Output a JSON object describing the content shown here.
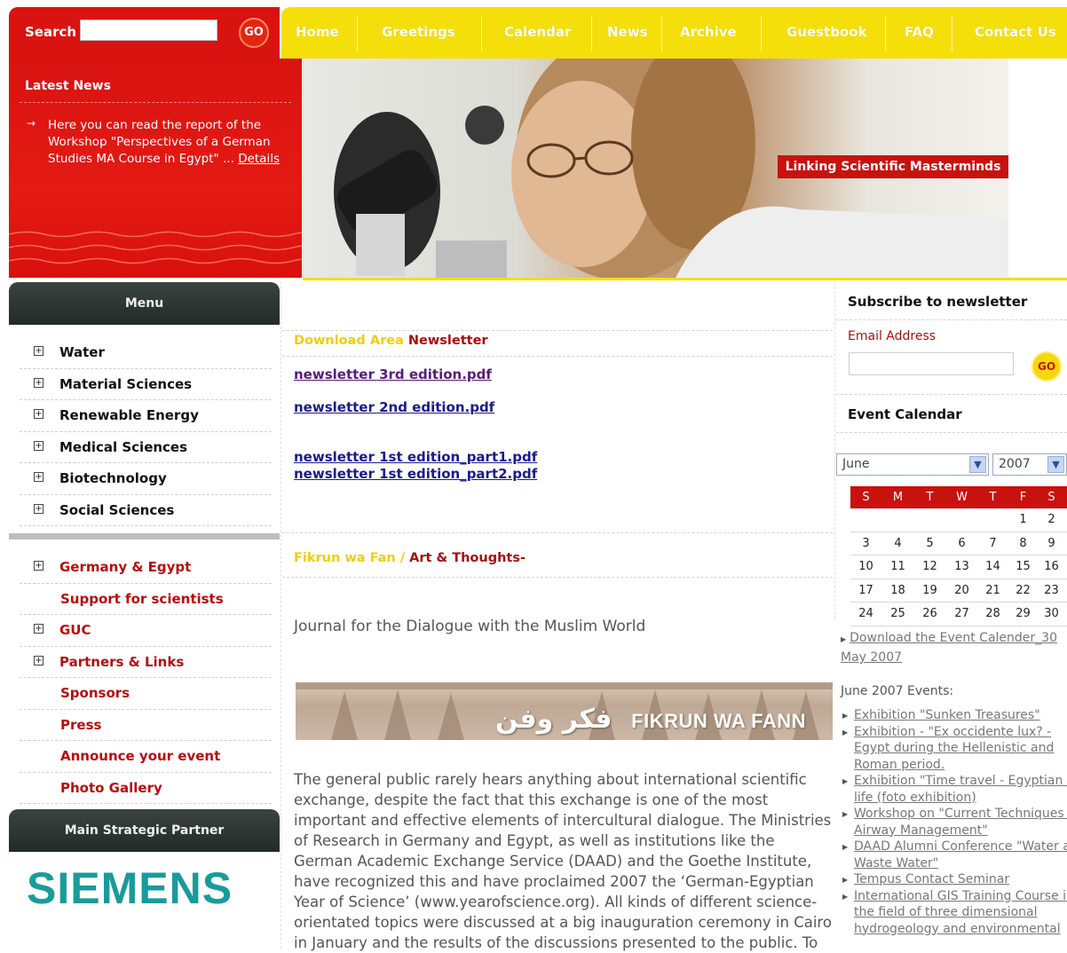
{
  "search": {
    "label": "Search",
    "value": "",
    "go_label": "GO"
  },
  "nav": {
    "items": [
      "Home",
      "Greetings",
      "Calendar",
      "News",
      "Archive",
      "Guestbook",
      "FAQ",
      "Contact Us"
    ]
  },
  "latest_news": {
    "title": "Latest News",
    "text": "Here you can read the report of the Workshop \"Perspectives of a German Studies MA Course in Egypt\" ... ",
    "details_link": "Details"
  },
  "hero": {
    "tagline": "Linking Scientific Masterminds"
  },
  "menu": {
    "title": "Menu",
    "science_items": [
      "Water",
      "Material Sciences",
      "Renewable Energy",
      "Medical Sciences",
      "Biotechnology",
      "Social Sciences"
    ],
    "info_items": [
      {
        "label": "Germany & Egypt",
        "expandable": true
      },
      {
        "label": "Support for scientists",
        "expandable": false
      },
      {
        "label": "GUC",
        "expandable": true
      },
      {
        "label": "Partners & Links",
        "expandable": true
      },
      {
        "label": "Sponsors",
        "expandable": false
      },
      {
        "label": "Press",
        "expandable": false
      },
      {
        "label": "Announce your event",
        "expandable": false
      },
      {
        "label": "Photo Gallery",
        "expandable": false
      }
    ]
  },
  "partner": {
    "title": "Main Strategic Partner",
    "logo_text": "SIEMENS"
  },
  "download": {
    "title_part1": "Download Area",
    "title_part2": "Newsletter",
    "links": [
      "newsletter 3rd edition.pdf",
      "newsletter 2nd edition.pdf",
      "newsletter 1st edition_part1.pdf",
      "newsletter 1st edition_part2.pdf"
    ]
  },
  "fikrun": {
    "title_part1": "Fikrun wa  Fan /",
    "title_part2": "Art & Thoughts-",
    "subtitle": "Journal for the Dialogue with the Muslim World",
    "banner_text": "FIKRUN WA FANN",
    "banner_arabic": "فكر وفن",
    "body": "The general public rarely hears anything about international scientific exchange, despite the fact that this exchange is one of the most important and effective elements of intercultural dialogue. The Ministries of Research in Germany and Egypt, as well as institutions like the German Academic Exchange Service (DAAD) and the Goethe Institute, have recognized this and have proclaimed 2007 the ‘German-Egyptian Year of Science’ (www.yearofscience.org). All kinds of different science-orientated topics were discussed at a big inauguration ceremony in Cairo in January and the results of the discussions presented to the public. To"
  },
  "newsletter": {
    "title": "Subscribe to newsletter",
    "email_label": "Email Address",
    "email_value": "",
    "go_label": "GO"
  },
  "event_calendar": {
    "title": "Event Calendar",
    "month": "June",
    "year": "2007",
    "weekdays": [
      "S",
      "M",
      "T",
      "W",
      "T",
      "F",
      "S"
    ],
    "weeks": [
      [
        "",
        "",
        "",
        "",
        "",
        "1",
        "2"
      ],
      [
        "3",
        "4",
        "5",
        "6",
        "7",
        "8",
        "9"
      ],
      [
        "10",
        "11",
        "12",
        "13",
        "14",
        "15",
        "16"
      ],
      [
        "17",
        "18",
        "19",
        "20",
        "21",
        "22",
        "23"
      ],
      [
        "24",
        "25",
        "26",
        "27",
        "28",
        "29",
        "30"
      ]
    ],
    "download_link": "Download the Event Calender_30 May 2007"
  },
  "june_events": {
    "title": "June 2007 Events:",
    "items": [
      [
        "Exhibition \"Sunken Treasures\""
      ],
      [
        "Exhibition - \"Ex occidente lux? -",
        "Egypt during the Hellenistic and",
        "Roman period."
      ],
      [
        "Exhibition \"Time travel - Egyptian st",
        "life (foto exhibition)"
      ],
      [
        "Workshop on \"Current Techniques in",
        "Airway Management\""
      ],
      [
        "DAAD Alumni Conference \"Water an",
        "Waste Water\""
      ],
      [
        "Tempus Contact Seminar"
      ],
      [
        "International GIS Training Course in",
        "the field of three dimensional",
        "hydrogeology and environmental"
      ]
    ]
  }
}
